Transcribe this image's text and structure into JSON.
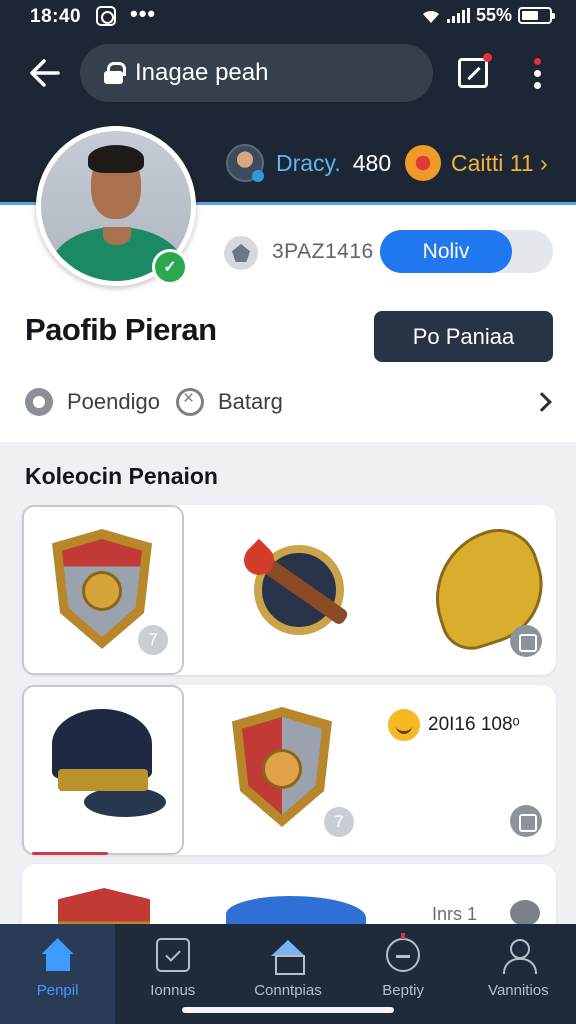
{
  "status_bar": {
    "time": "18:40",
    "more": "•••",
    "battery": "55%"
  },
  "header": {
    "url": "Inagae peah"
  },
  "stats": [
    {
      "name": "Dracy.",
      "value": "480"
    },
    {
      "name": "Caitti 11 ›",
      "value": ""
    }
  ],
  "profile": {
    "verified_badge": "✓",
    "code": "3PAZ1416",
    "toggle_label": "Noliv",
    "name": "Paofib Pieran",
    "button_label": "Po Paniaa",
    "info": [
      "Poendigo",
      "Batarg"
    ]
  },
  "collection": {
    "title": "Koleocin Penaion",
    "row1": {
      "badge_1": "7"
    },
    "row2": {
      "badge_2": "7",
      "reward_text": "20I16 108ᵒ"
    },
    "row3": {
      "partial_text": "Inrs 1"
    }
  },
  "bottom_nav": [
    {
      "label": "Penpil",
      "icon": "home-icon",
      "active": true
    },
    {
      "label": "Ionnus",
      "icon": "tasks-icon",
      "active": false
    },
    {
      "label": "Conntpias",
      "icon": "shop-icon",
      "active": false
    },
    {
      "label": "Beptiy",
      "icon": "clock-icon",
      "active": false
    },
    {
      "label": "Vannitios",
      "icon": "user-icon",
      "active": false
    }
  ],
  "colors": {
    "accent": "#2177f0",
    "header": "#1d2634",
    "nav_active": "#3f9cff"
  }
}
